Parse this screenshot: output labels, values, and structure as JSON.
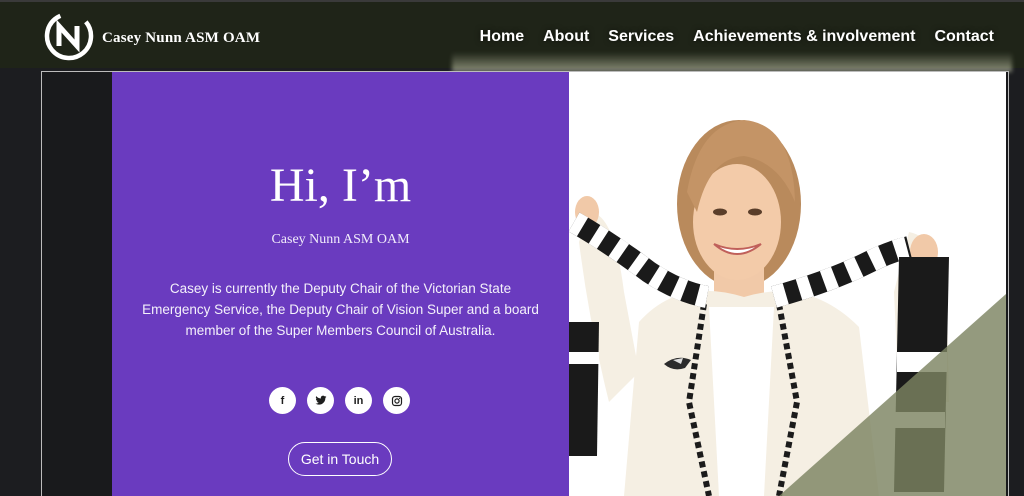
{
  "header": {
    "brand": "Casey Nunn ASM OAM",
    "logo_letters": "CN",
    "nav": [
      "Home",
      "About",
      "Services",
      "Achievements & involvement",
      "Contact"
    ]
  },
  "hero": {
    "title": "Hi, I’m",
    "name": "Casey Nunn ASM OAM",
    "description": "Casey is currently the Deputy Chair of the Victorian State Emergency Service, the Deputy Chair of Vision Super and a board member of the Super Members Council of Australia.",
    "socials": [
      {
        "icon": "facebook-icon",
        "glyph": "f"
      },
      {
        "icon": "twitter-icon",
        "glyph": "🐦"
      },
      {
        "icon": "linkedin-icon",
        "glyph": "in"
      },
      {
        "icon": "instagram-icon",
        "glyph": "◎"
      }
    ],
    "cta_label": "Get in Touch"
  },
  "colors": {
    "header_bg": "#1f2418",
    "hero_purple": "#6a3bbf",
    "overlay_olive": "#7d8462"
  }
}
